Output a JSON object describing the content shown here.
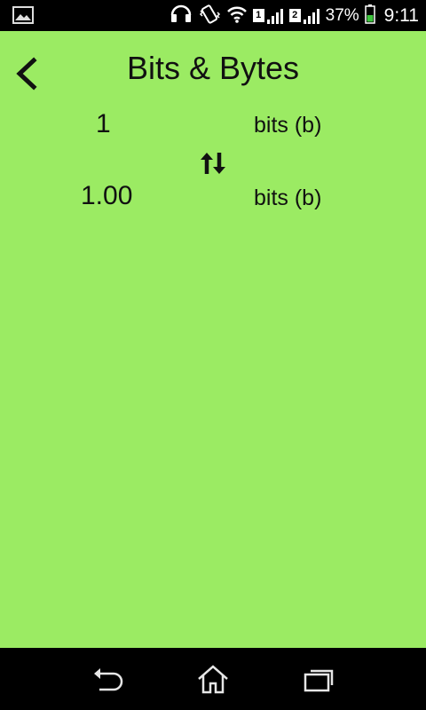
{
  "status_bar": {
    "sim1": "1",
    "sim2": "2",
    "battery": "37%",
    "time": "9:11",
    "battery_color": "#3cc43c",
    "icons": [
      "image-icon",
      "headset-icon",
      "vibrate-icon",
      "wifi-icon",
      "signal-icon",
      "battery-icon"
    ]
  },
  "header": {
    "title": "Bits & Bytes",
    "back_icon": "chevron-left-icon"
  },
  "converter": {
    "input_value": "1",
    "input_unit": "bits (b)",
    "swap_icon": "swap-vertical-icon",
    "output_value": "1.00",
    "output_unit": "bits (b)"
  },
  "theme": {
    "background": "#9beb63"
  },
  "nav": {
    "icons": [
      "back-icon",
      "home-icon",
      "recents-icon"
    ]
  }
}
